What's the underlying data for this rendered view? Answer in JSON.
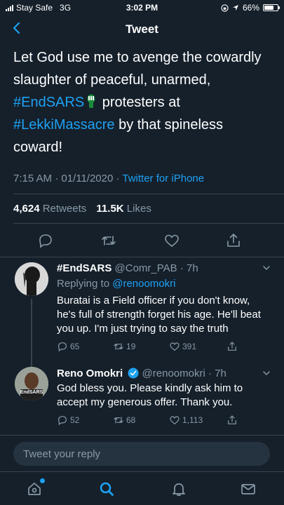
{
  "status_bar": {
    "carrier": "Stay Safe",
    "network": "3G",
    "time": "3:02 PM",
    "battery": "66%"
  },
  "nav": {
    "title": "Tweet",
    "back_icon": "chevron-left-icon"
  },
  "tweet": {
    "text_1": "Let God use me to avenge the cowardly slaughter of peaceful, unarmed, ",
    "hashtag_1": "#EndSARS",
    "text_2": " protesters at ",
    "hashtag_2": "#LekkiMassacre",
    "text_3": " by that spineless coward!",
    "time": "7:15 AM · 01/11/2020 · ",
    "source": "Twitter for iPhone",
    "retweets_count": "4,624",
    "retweets_label": "Retweets",
    "likes_count": "11.5K",
    "likes_label": "Likes"
  },
  "replies": [
    {
      "name": "#EndSARS",
      "handle": "@Comr_PAB · 7h",
      "replying_prefix": "Replying to ",
      "replying_to": "@renoomokri",
      "body": "Buratai is a Field officer if you don't know, he's full of strength forget his age. He'll beat you up. I'm just trying to say the truth",
      "reply_count": "65",
      "retweet_count": "19",
      "like_count": "391"
    },
    {
      "name": "Reno Omokri",
      "handle": "@renoomokri · 7h",
      "body": "God bless you. Please kindly ask him to accept my generous offer. Thank you.",
      "avatar_text": "EndSARS",
      "reply_count": "52",
      "retweet_count": "68",
      "like_count": "1,113"
    }
  ],
  "compose": {
    "placeholder": "Tweet your reply"
  },
  "colors": {
    "background": "#15202b",
    "accent": "#1da1f2",
    "muted": "#8899a6",
    "divider": "#38444d"
  }
}
